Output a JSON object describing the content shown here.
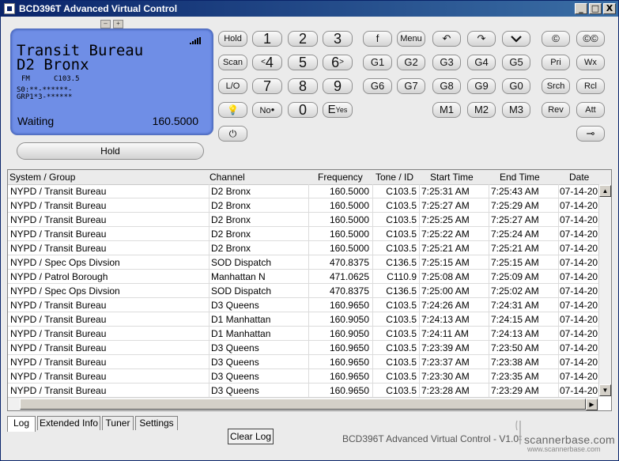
{
  "window": {
    "title": "BCD396T Advanced Virtual Control",
    "buttons": [
      "_",
      "□",
      "X"
    ]
  },
  "lcd": {
    "line1": "Transit Bureau",
    "line2": "D2 Bronx",
    "modulation": "FM",
    "tone": "C103.5",
    "s_line": "S0:**-******-",
    "grp_line": "GRP1*3-******",
    "status": "Waiting",
    "frequency": "160.5000"
  },
  "hold_label": "Hold",
  "keypad": {
    "hold": "Hold",
    "scan": "Scan",
    "lo": "L/O",
    "no": "No",
    "k1": "1",
    "k2": "2",
    "k3": "3",
    "k4": "4",
    "k5": "5",
    "k6": "6",
    "k7": "7",
    "k8": "8",
    "k9": "9",
    "k0": "0",
    "e": "E",
    "yes": "Yes",
    "lt": "<",
    "gt": ">"
  },
  "func_keys": {
    "f": "f",
    "menu": "Menu",
    "g1": "G1",
    "g2": "G2",
    "g3": "G3",
    "g4": "G4",
    "g5": "G5",
    "g6": "G6",
    "g7": "G7",
    "g8": "G8",
    "g9": "G9",
    "g0": "G0",
    "m1": "M1",
    "m2": "M2",
    "m3": "M3",
    "copy": "©",
    "copy2": "©©",
    "pri": "Pri",
    "wx": "Wx",
    "srch": "Srch",
    "rcl": "Rcl",
    "rev": "Rev",
    "att": "Att"
  },
  "table": {
    "headers": [
      "System / Group",
      "Channel",
      "Frequency",
      "Tone / ID",
      "Start Time",
      "End Time",
      "Date"
    ],
    "rows": [
      [
        "NYPD / Transit Bureau",
        "D2 Bronx",
        "160.5000",
        "C103.5",
        "7:25:31 AM",
        "7:25:43 AM",
        "07-14-20"
      ],
      [
        "NYPD / Transit Bureau",
        "D2 Bronx",
        "160.5000",
        "C103.5",
        "7:25:27 AM",
        "7:25:29 AM",
        "07-14-20"
      ],
      [
        "NYPD / Transit Bureau",
        "D2 Bronx",
        "160.5000",
        "C103.5",
        "7:25:25 AM",
        "7:25:27 AM",
        "07-14-20"
      ],
      [
        "NYPD / Transit Bureau",
        "D2 Bronx",
        "160.5000",
        "C103.5",
        "7:25:22 AM",
        "7:25:24 AM",
        "07-14-20"
      ],
      [
        "NYPD / Transit Bureau",
        "D2 Bronx",
        "160.5000",
        "C103.5",
        "7:25:21 AM",
        "7:25:21 AM",
        "07-14-20"
      ],
      [
        "NYPD / Spec Ops Divsion",
        "SOD Dispatch",
        "470.8375",
        "C136.5",
        "7:25:15 AM",
        "7:25:15 AM",
        "07-14-20"
      ],
      [
        "NYPD / Patrol Borough",
        "Manhattan N",
        "471.0625",
        "C110.9",
        "7:25:08 AM",
        "7:25:09 AM",
        "07-14-20"
      ],
      [
        "NYPD / Spec Ops Divsion",
        "SOD Dispatch",
        "470.8375",
        "C136.5",
        "7:25:00 AM",
        "7:25:02 AM",
        "07-14-20"
      ],
      [
        "NYPD / Transit Bureau",
        "D3 Queens",
        "160.9650",
        "C103.5",
        "7:24:26 AM",
        "7:24:31 AM",
        "07-14-20"
      ],
      [
        "NYPD / Transit Bureau",
        "D1 Manhattan",
        "160.9050",
        "C103.5",
        "7:24:13 AM",
        "7:24:15 AM",
        "07-14-20"
      ],
      [
        "NYPD / Transit Bureau",
        "D1 Manhattan",
        "160.9050",
        "C103.5",
        "7:24:11 AM",
        "7:24:13 AM",
        "07-14-20"
      ],
      [
        "NYPD / Transit Bureau",
        "D3 Queens",
        "160.9650",
        "C103.5",
        "7:23:39 AM",
        "7:23:50 AM",
        "07-14-20"
      ],
      [
        "NYPD / Transit Bureau",
        "D3 Queens",
        "160.9650",
        "C103.5",
        "7:23:37 AM",
        "7:23:38 AM",
        "07-14-20"
      ],
      [
        "NYPD / Transit Bureau",
        "D3 Queens",
        "160.9650",
        "C103.5",
        "7:23:30 AM",
        "7:23:35 AM",
        "07-14-20"
      ],
      [
        "NYPD / Transit Bureau",
        "D3 Queens",
        "160.9650",
        "C103.5",
        "7:23:28 AM",
        "7:23:29 AM",
        "07-14-20"
      ]
    ]
  },
  "tabs": [
    "Log",
    "Extended Info",
    "Tuner",
    "Settings"
  ],
  "clear_log": "Clear Log",
  "footer": "BCD396T Advanced Virtual Control - V1.0",
  "logo": {
    "brand": "scannerbase.com",
    "url": "www.scannerbase.com"
  }
}
